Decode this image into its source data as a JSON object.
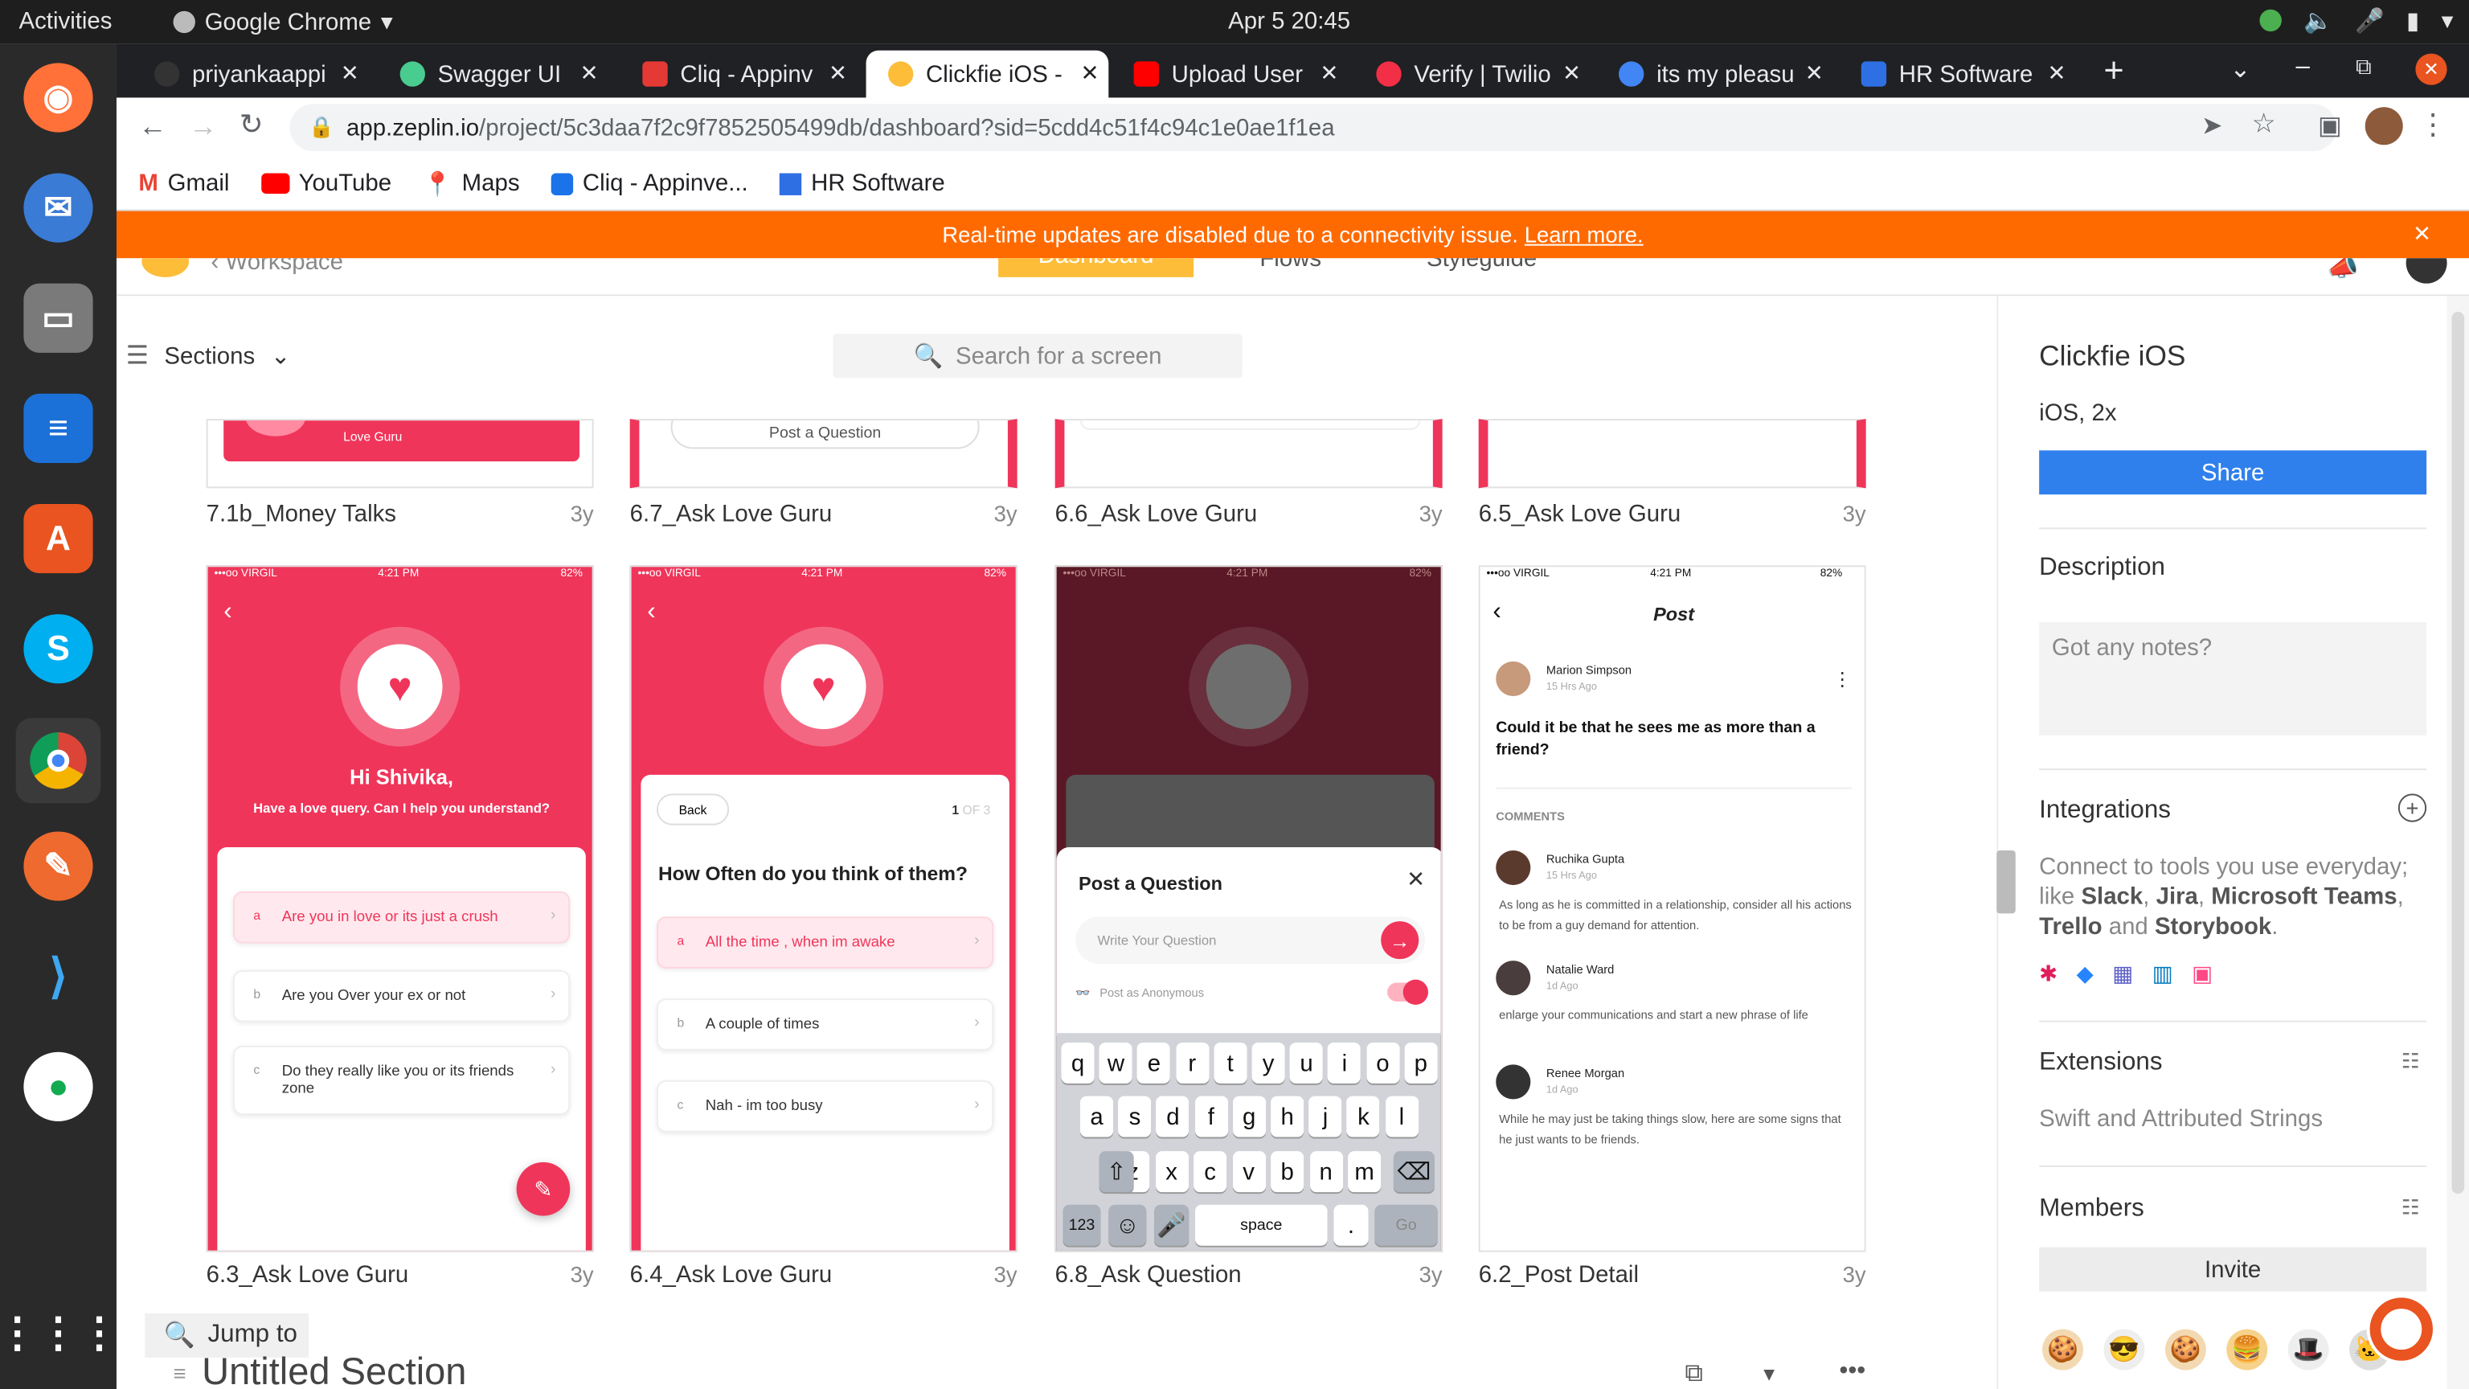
{
  "system": {
    "activities": "Activities",
    "app_name": "Google Chrome",
    "clock": "Apr 5  20:45"
  },
  "browser": {
    "tabs": [
      {
        "label": "priyankaappi",
        "color": "#333333"
      },
      {
        "label": "Swagger UI",
        "color": "#49cc90"
      },
      {
        "label": "Cliq - Appinv",
        "color": "#e53935"
      },
      {
        "label": "Clickfie iOS -",
        "color": "#fdbd39"
      },
      {
        "label": "Upload User",
        "color": "#ff0000"
      },
      {
        "label": "Verify | Twilio",
        "color": "#f22f46"
      },
      {
        "label": "its my pleasu",
        "color": "#4285f4"
      },
      {
        "label": "HR Software",
        "color": "#2f6fe4"
      }
    ],
    "new_tab": "+",
    "url_host": "app.zeplin.io",
    "url_path": "/project/5c3daa7f2c9f7852505499db/dashboard?sid=5cdd4c51f4c94c1e0ae1f1ea",
    "bookmarks": [
      "Gmail",
      "YouTube",
      "Maps",
      "Cliq - Appinve...",
      "HR Software"
    ]
  },
  "banner": {
    "text": "Real-time updates are disabled due to a connectivity issue.",
    "link": "Learn more."
  },
  "zeplin_header": {
    "back_label": "Workspace",
    "tabs": [
      "Dashboard",
      "Flows",
      "Styleguide"
    ]
  },
  "toolbar": {
    "sections_label": "Sections",
    "search_placeholder": "Search for a screen"
  },
  "top_row": [
    {
      "name": "7.1b_Money Talks",
      "age": "3y",
      "snippet": "Love Guru"
    },
    {
      "name": "6.7_Ask Love Guru",
      "age": "3y",
      "snippet": "Post a Question"
    },
    {
      "name": "6.6_Ask Love Guru",
      "age": "3y",
      "snippet": ""
    },
    {
      "name": "6.5_Ask Love Guru",
      "age": "3y",
      "snippet": ""
    }
  ],
  "screens": {
    "s63": {
      "name": "6.3_Ask Love Guru",
      "age": "3y",
      "status": {
        "carrier": "•••oo VIRGIL",
        "time": "4:21 PM",
        "battery": "82%"
      },
      "greeting": "Hi Shivika,",
      "subtitle": "Have a love query. Can I help you understand?",
      "options": [
        {
          "letter": "a",
          "text": "Are you in love or its just a crush"
        },
        {
          "letter": "b",
          "text": "Are you Over your ex or not"
        },
        {
          "letter": "c",
          "text": "Do they really like you or its friends zone"
        }
      ]
    },
    "s64": {
      "name": "6.4_Ask Love Guru",
      "age": "3y",
      "status": {
        "carrier": "•••oo VIRGIL",
        "time": "4:21 PM",
        "battery": "82%"
      },
      "back": "Back",
      "step": "1",
      "step_total": "OF 3",
      "question": "How Often do you think of them?",
      "options": [
        {
          "letter": "a",
          "text": "All the time , when im awake"
        },
        {
          "letter": "b",
          "text": "A couple of times"
        },
        {
          "letter": "c",
          "text": "Nah - im too busy"
        }
      ]
    },
    "s68": {
      "name": "6.8_Ask Question",
      "age": "3y",
      "status": {
        "carrier": "•••oo VIRGIL",
        "time": "4:21 PM",
        "battery": "82%"
      },
      "sheet_title": "Post a Question",
      "input_placeholder": "Write Your Question",
      "anon_label": "Post as Anonymous",
      "keys_row1": [
        "q",
        "w",
        "e",
        "r",
        "t",
        "y",
        "u",
        "i",
        "o",
        "p"
      ],
      "keys_row2": [
        "a",
        "s",
        "d",
        "f",
        "g",
        "h",
        "j",
        "k",
        "l"
      ],
      "keys_row3": [
        "z",
        "x",
        "c",
        "v",
        "b",
        "n",
        "m"
      ],
      "key_123": "123",
      "key_space": "space",
      "key_dot": ".",
      "key_go": "Go"
    },
    "s62": {
      "name": "6.2_Post Detail",
      "age": "3y",
      "status": {
        "carrier": "•••oo VIRGIL",
        "time": "4:21 PM",
        "battery": "82%"
      },
      "title": "Post",
      "author": "Marion Simpson",
      "author_time": "15 Hrs Ago",
      "question": "Could it be that he sees me as more than a friend?",
      "comments_label": "COMMENTS",
      "comments": [
        {
          "name": "Ruchika Gupta",
          "time": "15 Hrs Ago",
          "text": "As long as he is committed in a relationship, consider all his actions to be from a guy demand for attention."
        },
        {
          "name": "Natalie Ward",
          "time": "1d Ago",
          "text": "enlarge your communications and start a new phrase of life"
        },
        {
          "name": "Renee Morgan",
          "time": "1d Ago",
          "text": "While he may just be taking things slow, here are some signs that he just wants to be friends."
        }
      ]
    }
  },
  "footer": {
    "jump_to": "Jump to",
    "section_title": "Untitled Section"
  },
  "panel": {
    "project_name": "Clickfie iOS",
    "platform": "iOS, 2x",
    "share": "Share",
    "description_label": "Description",
    "notes_placeholder": "Got any notes?",
    "integrations_label": "Integrations",
    "integrations_text_1": "Connect to tools you use everyday; like",
    "integrations_tools": [
      "Slack",
      "Jira",
      "Microsoft Teams",
      "Trello",
      "Storybook"
    ],
    "extensions_label": "Extensions",
    "extensions_text": "Swift and Attributed Strings",
    "members_label": "Members",
    "invite": "Invite"
  },
  "colors": {
    "pink": "#f0355a",
    "orange": "#ff6a00",
    "blue": "#2f80ed",
    "zeplin_yellow": "#fdbd39"
  }
}
